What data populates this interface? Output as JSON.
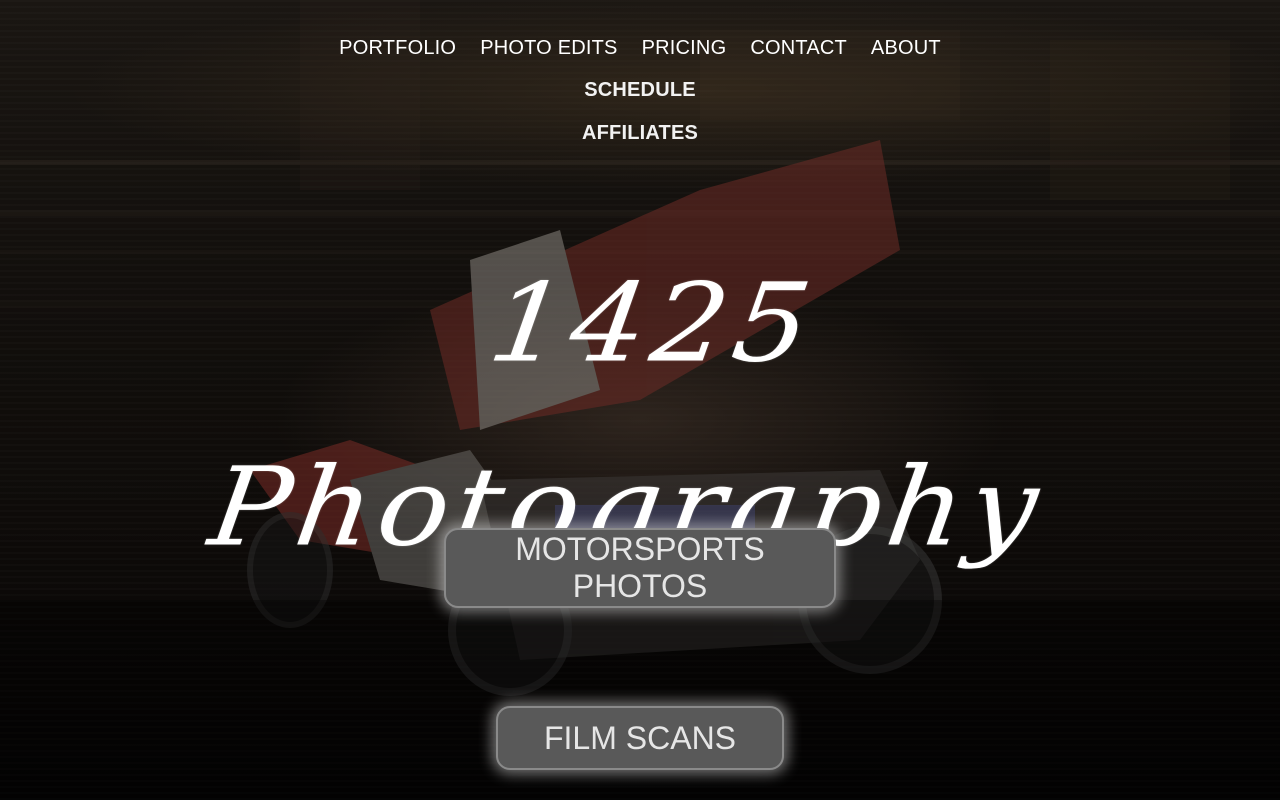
{
  "nav": {
    "row1": [
      "PORTFOLIO",
      "PHOTO EDITS",
      "PRICING",
      "CONTACT",
      "ABOUT"
    ],
    "schedule": "SCHEDULE",
    "affiliates": "AFFILIATES"
  },
  "hero": {
    "logo_text": "1425 Photography",
    "background": "sprint-car-motion-blur-photo"
  },
  "buttons": {
    "motorsports": "MOTORSPORTS PHOTOS",
    "film_scans": "FILM SCANS"
  },
  "colors": {
    "text": "#ffffff",
    "button_bg": "#595959",
    "button_border": "#8a8a8a"
  }
}
